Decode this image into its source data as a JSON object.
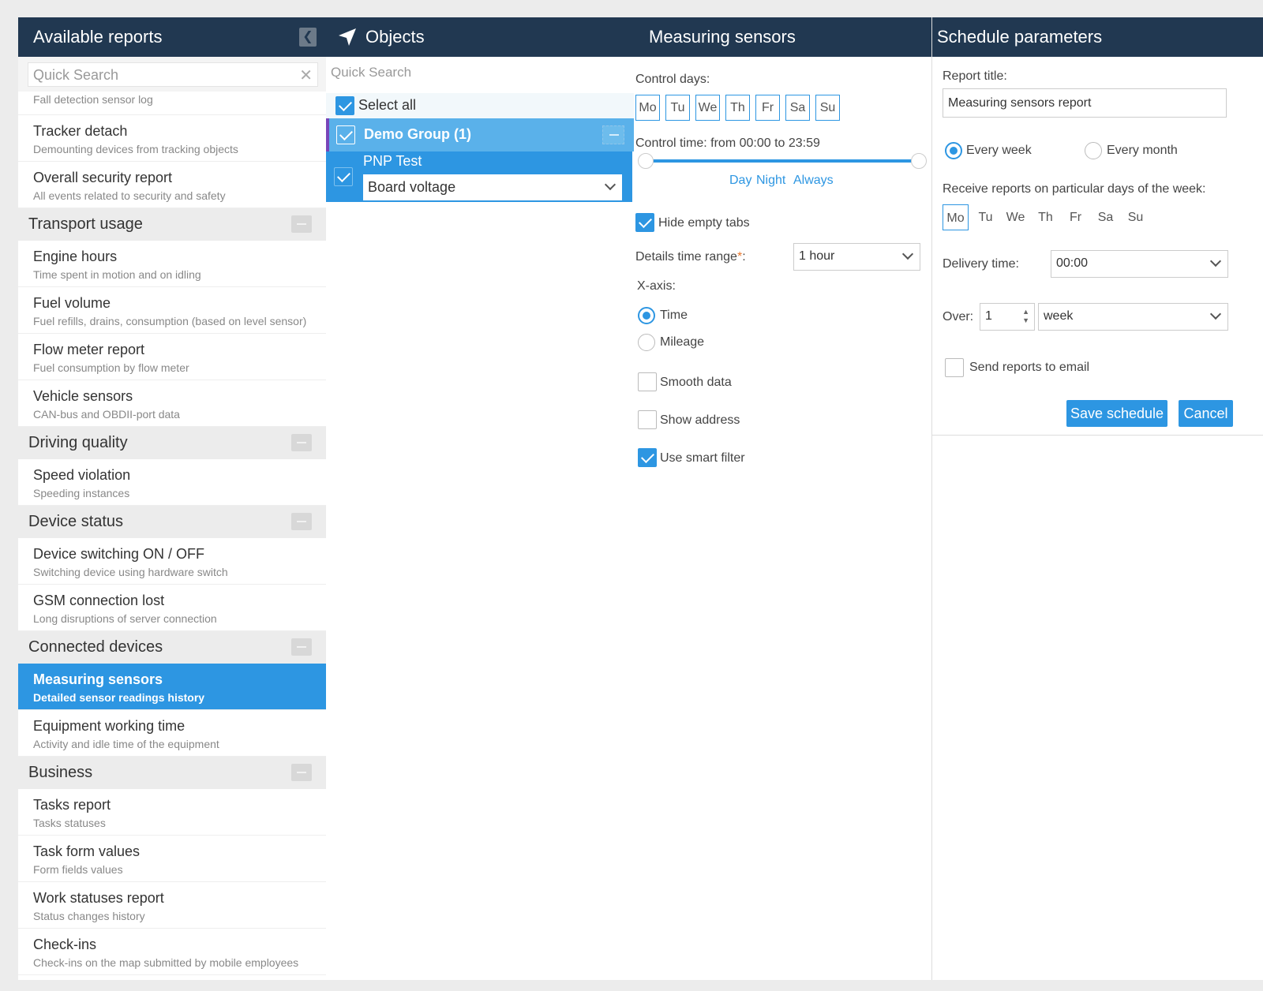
{
  "reports": {
    "title": "Available reports",
    "search_placeholder": "Quick Search",
    "partial_item": "Fall detection sensor log",
    "items_top": [
      {
        "title": "Tracker detach",
        "desc": "Demounting devices from tracking objects"
      },
      {
        "title": "Overall security report",
        "desc": "All events related to security and safety"
      }
    ],
    "groups": [
      {
        "name": "Transport usage",
        "items": [
          {
            "title": "Engine hours",
            "desc": "Time spent in motion and on idling"
          },
          {
            "title": "Fuel volume",
            "desc": "Fuel refills, drains, consumption (based on level sensor)"
          },
          {
            "title": "Flow meter report",
            "desc": "Fuel consumption by flow meter"
          },
          {
            "title": "Vehicle sensors",
            "desc": "CAN-bus and OBDII-port data"
          }
        ]
      },
      {
        "name": "Driving quality",
        "items": [
          {
            "title": "Speed violation",
            "desc": "Speeding instances"
          }
        ]
      },
      {
        "name": "Device status",
        "items": [
          {
            "title": "Device switching ON / OFF",
            "desc": "Switching device using hardware switch"
          },
          {
            "title": "GSM connection lost",
            "desc": "Long disruptions of server connection"
          }
        ]
      },
      {
        "name": "Connected devices",
        "items": [
          {
            "title": "Measuring sensors",
            "desc": "Detailed sensor readings history"
          },
          {
            "title": "Equipment working time",
            "desc": "Activity and idle time of the equipment"
          }
        ]
      },
      {
        "name": "Business",
        "items": [
          {
            "title": "Tasks report",
            "desc": "Tasks statuses"
          },
          {
            "title": "Task form values",
            "desc": "Form fields values"
          },
          {
            "title": "Work statuses report",
            "desc": "Status changes history"
          },
          {
            "title": "Check-ins",
            "desc": "Check-ins on the map submitted by mobile employees"
          }
        ]
      }
    ]
  },
  "objects": {
    "title": "Objects",
    "search_placeholder": "Quick Search",
    "select_all": "Select all",
    "group_label": "Demo Group (1)",
    "object_label": "PNP Test",
    "sensor_select": "Board voltage"
  },
  "sensors": {
    "title": "Measuring sensors",
    "control_days_label": "Control days:",
    "days": [
      "Mo",
      "Tu",
      "We",
      "Th",
      "Fr",
      "Sa",
      "Su"
    ],
    "control_time_label": "Control time: from 00:00 to 23:59",
    "presets": {
      "day": "Day",
      "night": "Night",
      "always": "Always"
    },
    "hide_empty_tabs": "Hide empty tabs",
    "details_range_label": "Details time range",
    "required_mark": "*",
    "colon": ":",
    "details_range_value": "1 hour",
    "xaxis_label": "X-axis:",
    "xaxis_time": "Time",
    "xaxis_mileage": "Mileage",
    "smooth_data": "Smooth data",
    "show_address": "Show address",
    "use_smart_filter": "Use smart filter"
  },
  "schedule": {
    "title": "Schedule parameters",
    "report_title_label": "Report title:",
    "report_title_value": "Measuring sensors report",
    "every_week": "Every week",
    "every_month": "Every month",
    "days_label": "Receive reports on particular days of the week:",
    "days": [
      "Mo",
      "Tu",
      "We",
      "Th",
      "Fr",
      "Sa",
      "Su"
    ],
    "delivery_label": "Delivery time:",
    "delivery_value": "00:00",
    "over_label": "Over:",
    "over_value": "1",
    "over_unit": "week",
    "send_email": "Send reports to email",
    "save_label": "Save schedule",
    "cancel_label": "Cancel"
  },
  "colors": {
    "header": "#213851",
    "accent": "#2d96e2",
    "group_bg": "#ececec"
  }
}
